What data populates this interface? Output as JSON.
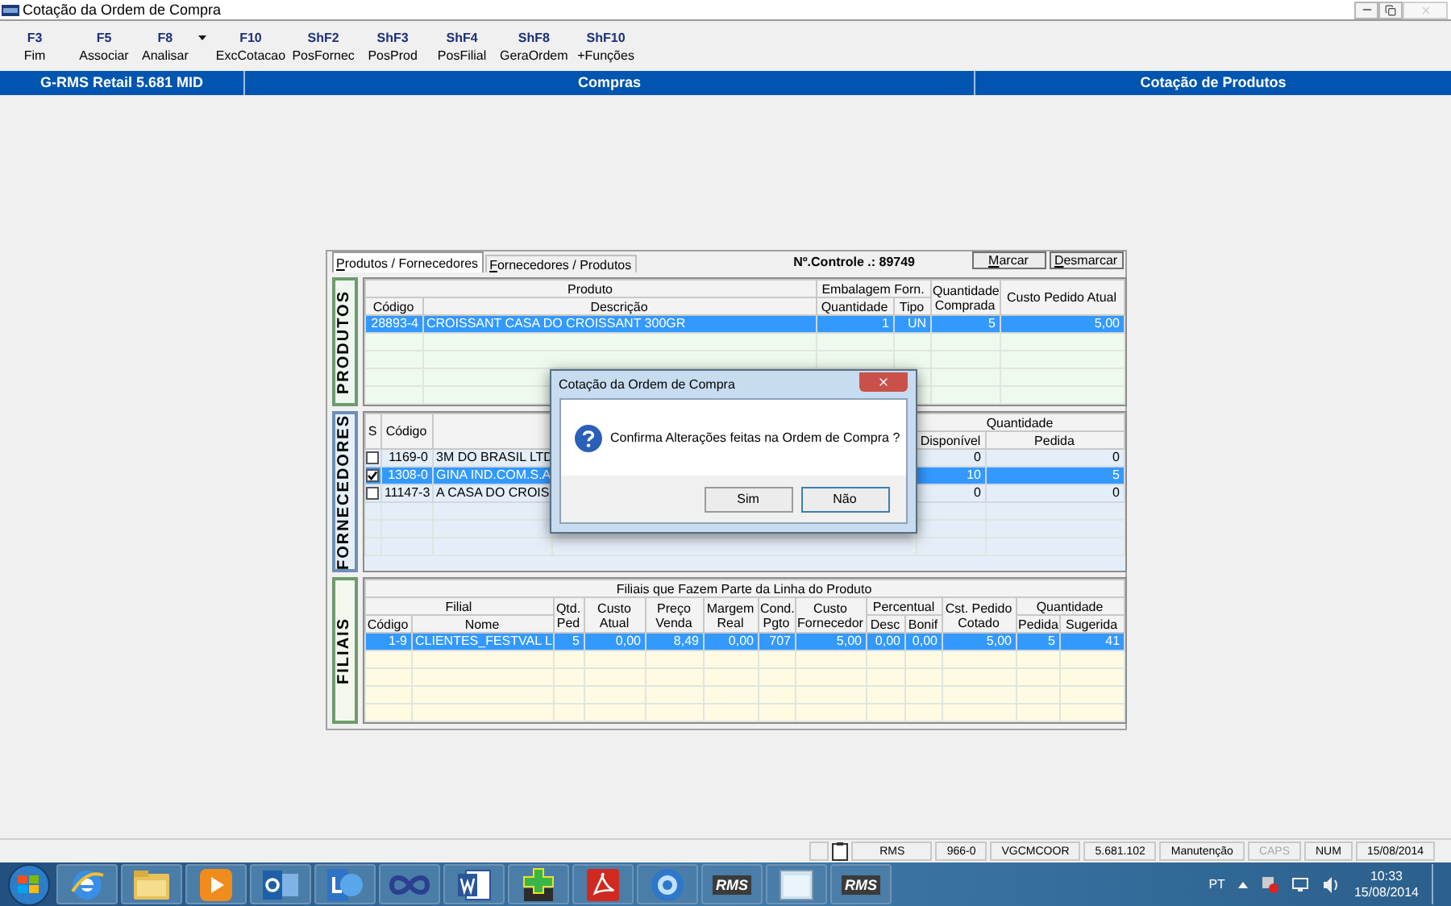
{
  "window": {
    "title": "Cotação da Ordem de Compra"
  },
  "toolbar": [
    {
      "key": "F3",
      "label": "Fim",
      "has_menu": false
    },
    {
      "key": "F5",
      "label": "Associar",
      "has_menu": false
    },
    {
      "key": "F8",
      "label": "Analisar",
      "has_menu": true
    },
    {
      "key": "F10",
      "label": "ExcCotacao",
      "has_menu": false
    },
    {
      "key": "ShF2",
      "label": "PosFornec",
      "has_menu": false
    },
    {
      "key": "ShF3",
      "label": "PosProd",
      "has_menu": false
    },
    {
      "key": "ShF4",
      "label": "PosFilial",
      "has_menu": false
    },
    {
      "key": "ShF8",
      "label": "GeraOrdem",
      "has_menu": false
    },
    {
      "key": "ShF10",
      "label": "+Funções",
      "has_menu": false
    }
  ],
  "header_bar": [
    "G-RMS Retail 5.681 MID",
    "Compras",
    "Cotação de Produtos"
  ],
  "panel": {
    "tabs": [
      {
        "label": "Produtos / Fornecedores",
        "selected": true
      },
      {
        "label": "Fornecedores / Produtos",
        "selected": false
      }
    ],
    "control_number": "Nº.Controle .: 89749",
    "buttons": [
      "Marcar",
      "Desmarcar"
    ],
    "sections": [
      {
        "label": "PRODUTOS",
        "header": [
          {
            "label": "Produto",
            "columns": [
              "Código",
              "Descrição"
            ]
          },
          {
            "label": "Embalagem Forn.",
            "columns": [
              "Quantidade",
              "Tipo"
            ]
          },
          {
            "columns": [
              "Quantidade Comprada"
            ]
          },
          {
            "columns": [
              "Custo Pedido Atual"
            ]
          }
        ],
        "rows": [
          {
            "selected": true,
            "cells": [
              "28893-4",
              "CROISSANT CASA DO CROISSANT 300GR",
              "1",
              "UN",
              "5",
              "5,00"
            ]
          }
        ]
      },
      {
        "label": "FORNECEDORES",
        "header": [
          {
            "columns": [
              "S",
              "Código"
            ]
          },
          {
            "kind": "covered"
          },
          {
            "label": "Quantidade",
            "columns": [
              "Disponível",
              "Pedida"
            ]
          }
        ],
        "rows": [
          {
            "selected": false,
            "checked": false,
            "cells": [
              "1169-0",
              "3M DO BRASIL LTD",
              "0",
              "0"
            ]
          },
          {
            "selected": true,
            "checked": true,
            "cells": [
              "1308-0",
              "GINA IND.COM.S.A",
              "10",
              "5"
            ]
          },
          {
            "selected": false,
            "checked": false,
            "cells": [
              "11147-3",
              "A CASA DO CROIS",
              "0",
              "0"
            ]
          }
        ]
      },
      {
        "label": "FILIAIS",
        "title": "Filiais que Fazem Parte da Linha do Produto",
        "header": [
          {
            "label": "Filial",
            "columns": [
              "Código",
              "Nome"
            ]
          },
          {
            "columns": [
              "Qtd. Ped"
            ]
          },
          {
            "columns": [
              "Custo Atual"
            ]
          },
          {
            "columns": [
              "Preço Venda"
            ]
          },
          {
            "columns": [
              "Margem Real"
            ]
          },
          {
            "columns": [
              "Cond. Pgto"
            ]
          },
          {
            "columns": [
              "Custo Fornecedor"
            ]
          },
          {
            "label": "Percentual",
            "columns": [
              "Desc",
              "Bonif"
            ]
          },
          {
            "columns": [
              "Cst. Pedido Cotado"
            ]
          },
          {
            "label": "Quantidade",
            "columns": [
              "Pedida",
              "Sugerida"
            ]
          }
        ],
        "rows": [
          {
            "selected": true,
            "cells": [
              "1-9",
              "CLIENTES_FESTVAL L",
              "5",
              "0,00",
              "8,49",
              "0,00",
              "707",
              "5,00",
              "0,00",
              "0,00",
              "5,00",
              "5",
              "41"
            ]
          }
        ]
      }
    ]
  },
  "dialog": {
    "title": "Cotação da Ordem de Compra",
    "message": "Confirma Alterações feitas na Ordem de Compra ?",
    "buttons": [
      "Sim",
      "Não"
    ]
  },
  "status_bar": [
    {
      "text": "RMS",
      "disabled": false
    },
    {
      "text": "966-0",
      "disabled": false
    },
    {
      "text": "VGCMCOOR",
      "disabled": false
    },
    {
      "text": "5.681.102",
      "disabled": false
    },
    {
      "text": "Manutenção",
      "disabled": false
    },
    {
      "text": "CAPS",
      "disabled": true
    },
    {
      "text": "NUM",
      "disabled": false
    },
    {
      "text": "15/08/2014",
      "disabled": false
    }
  ],
  "taskbar": {
    "apps": [
      {
        "kind": "ie"
      },
      {
        "kind": "folder"
      },
      {
        "kind": "media"
      },
      {
        "kind": "outlook"
      },
      {
        "kind": "lync"
      },
      {
        "kind": "infinity"
      },
      {
        "kind": "word"
      },
      {
        "kind": "plus"
      },
      {
        "kind": "pdf"
      },
      {
        "kind": "globe"
      },
      {
        "kind": "rms",
        "label": "RMS"
      },
      {
        "kind": "window"
      },
      {
        "kind": "rms",
        "label": "RMS"
      }
    ],
    "language": "PT",
    "time": "10:33",
    "date": "15/08/2014"
  }
}
